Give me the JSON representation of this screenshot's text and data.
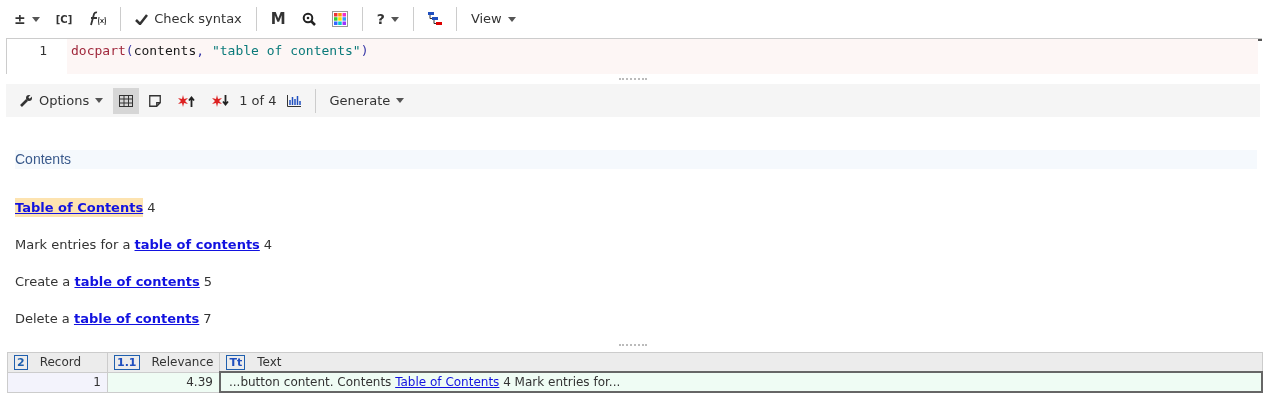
{
  "toolbar": [
    {
      "kind": "menu",
      "label": "±"
    },
    {
      "kind": "text",
      "label": "[C]"
    },
    {
      "kind": "function"
    },
    {
      "kind": "sep"
    },
    {
      "kind": "check",
      "label": "Check syntax"
    },
    {
      "kind": "sep"
    },
    {
      "kind": "bold",
      "label": "M"
    },
    {
      "kind": "zoom"
    },
    {
      "kind": "palette"
    },
    {
      "kind": "sep"
    },
    {
      "kind": "menu",
      "label": "?"
    },
    {
      "kind": "sep"
    },
    {
      "kind": "tree"
    },
    {
      "kind": "sep"
    },
    {
      "kind": "menu",
      "label": "View"
    }
  ],
  "editor": {
    "line_number": "1",
    "tokens": [
      {
        "kind": "fn",
        "text": "docpart"
      },
      {
        "kind": "punct",
        "text": "("
      },
      {
        "kind": "ident",
        "text": "contents"
      },
      {
        "kind": "punct",
        "text": ", "
      },
      {
        "kind": "string",
        "text": "\"table of contents\""
      },
      {
        "kind": "punct",
        "text": ")"
      }
    ]
  },
  "results_toolbar": [
    {
      "kind": "options",
      "label": "Options",
      "selected": false
    },
    {
      "kind": "table",
      "selected": true
    },
    {
      "kind": "note",
      "selected": false
    },
    {
      "kind": "prevhit",
      "selected": false
    },
    {
      "kind": "nexthit",
      "selected": false
    },
    {
      "kind": "label",
      "label": "1 of 4"
    },
    {
      "kind": "chart",
      "selected": false
    },
    {
      "kind": "sep"
    },
    {
      "kind": "menu",
      "label": "Generate",
      "selected": false
    }
  ],
  "document": {
    "heading": "Contents",
    "entries": [
      {
        "link": "Table of Contents",
        "page": "4",
        "selected": true
      },
      {
        "before": "Mark entries for a ",
        "link": "table of contents",
        "page": "4",
        "selected": false
      },
      {
        "before": "Create a ",
        "link": "table of contents",
        "page": "5",
        "selected": false
      },
      {
        "before": "Delete a ",
        "link": "table of contents",
        "page": "7",
        "selected": false
      }
    ]
  },
  "table": {
    "columns": [
      {
        "label": "Record",
        "type_badge": "2"
      },
      {
        "label": "Relevance",
        "type_badge": "1.1"
      },
      {
        "label": "Text",
        "type_badge": "Tt"
      }
    ],
    "rows": [
      {
        "record": "1",
        "relevance": "4.39",
        "text_before": "...button content. Contents ",
        "text_link": "Table of Contents",
        "text_after": " 4 Mark entries for..."
      }
    ]
  }
}
